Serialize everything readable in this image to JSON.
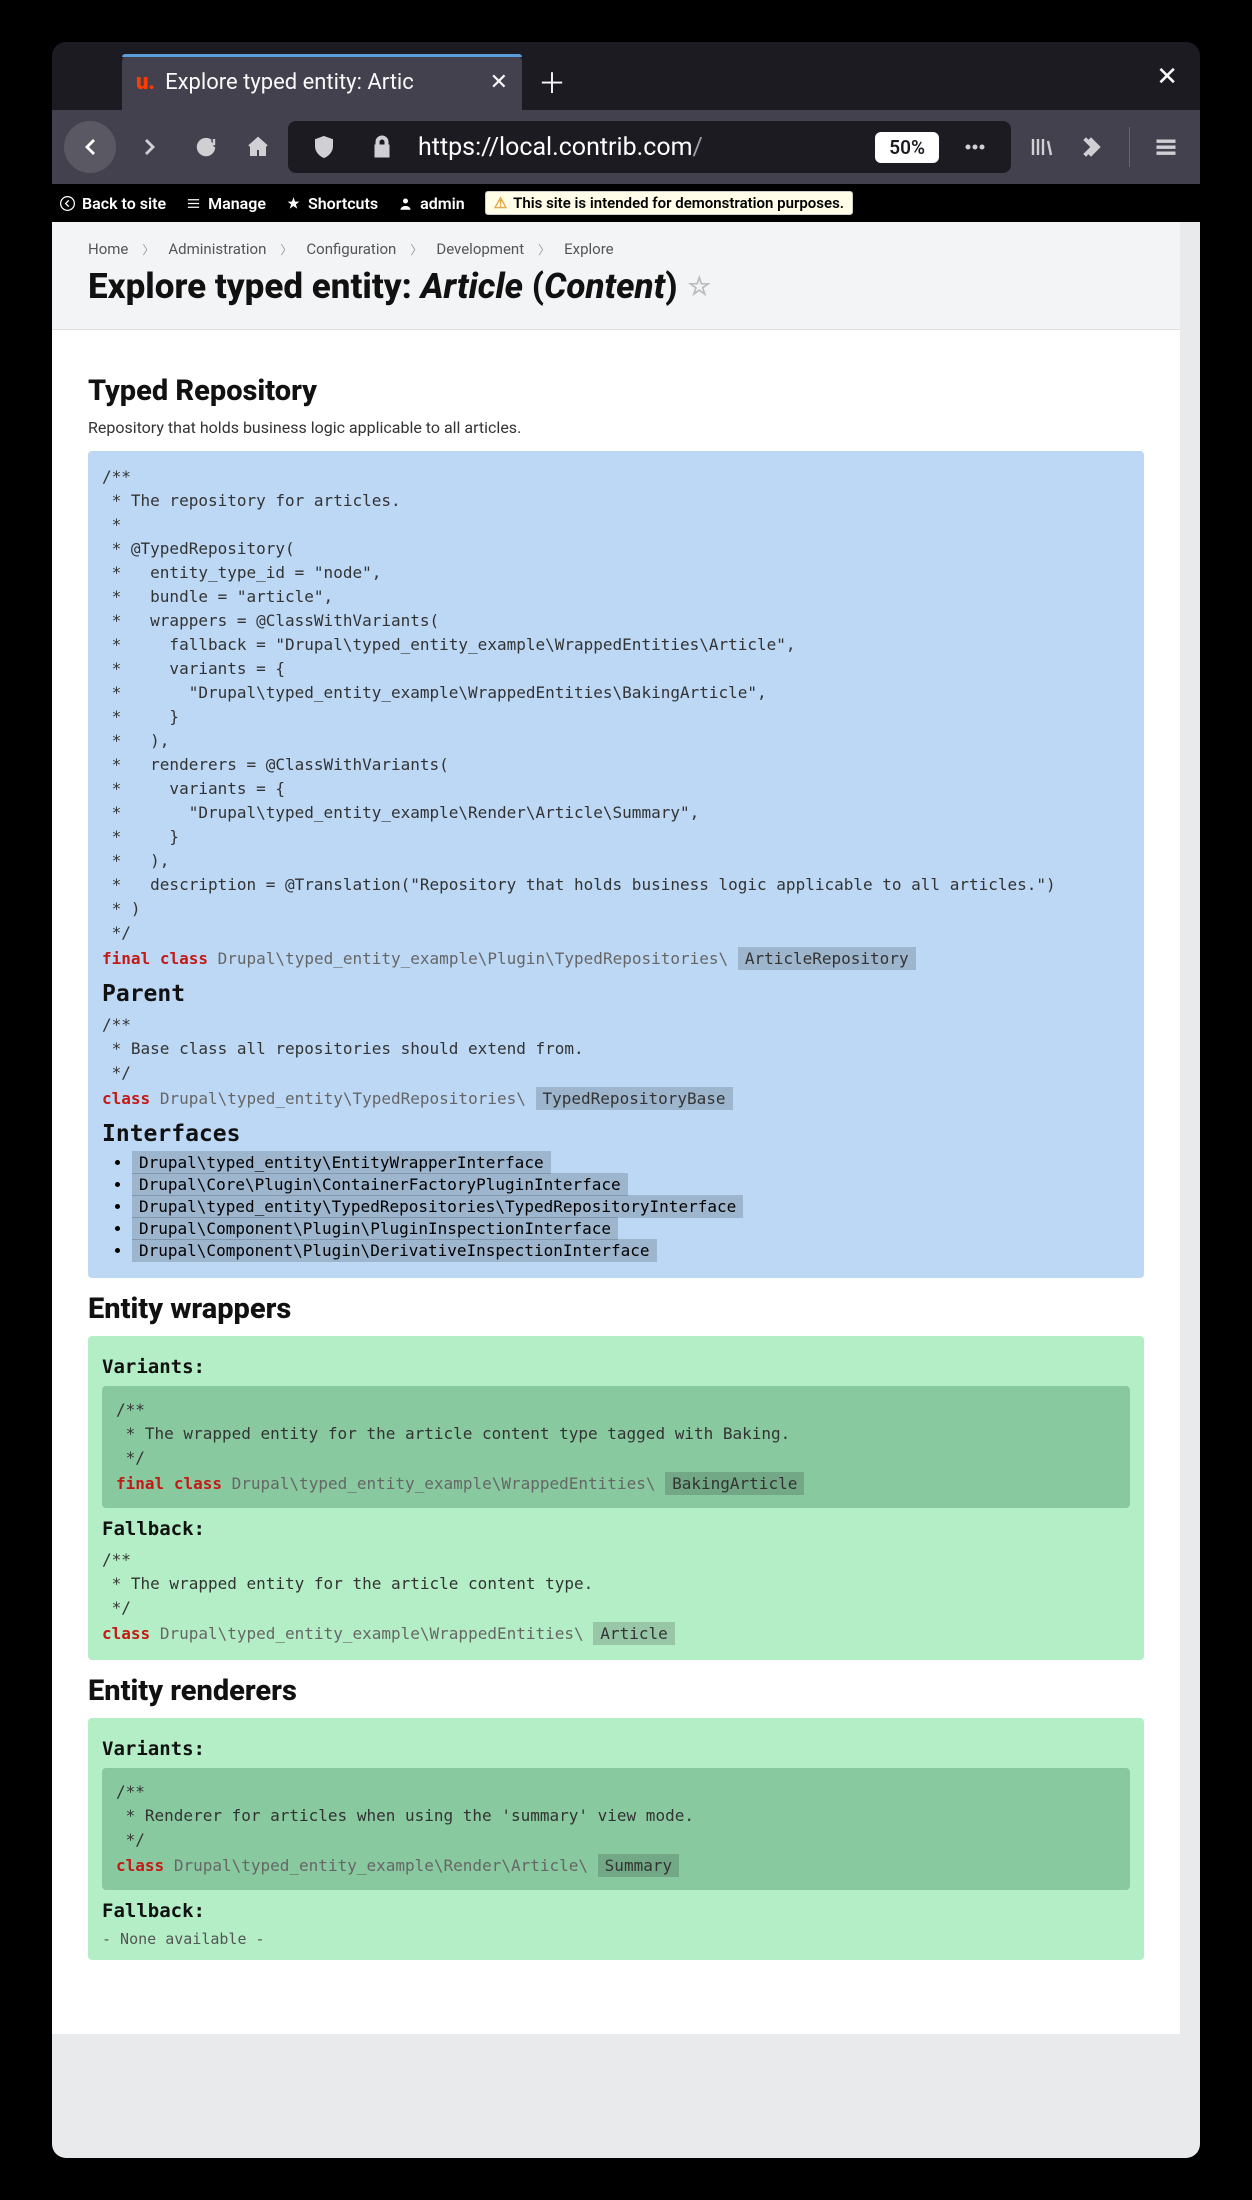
{
  "browser": {
    "tab_title": "Explore typed entity: Artic",
    "url_scheme": "https://",
    "url_domain": "local.contrib.com",
    "url_path": "/",
    "zoom": "50%"
  },
  "adminbar": {
    "back": "Back to site",
    "manage": "Manage",
    "shortcuts": "Shortcuts",
    "user": "admin",
    "warning": "This site is intended for demonstration purposes."
  },
  "breadcrumb": [
    "Home",
    "Administration",
    "Configuration",
    "Development",
    "Explore"
  ],
  "page_title": {
    "prefix": "Explore typed entity: ",
    "entity": "Article",
    "sub_open": " (",
    "sub": "Content",
    "sub_close": ")"
  },
  "sections": {
    "repo": {
      "heading": "Typed Repository",
      "desc": "Repository that holds business logic applicable to all articles.",
      "doc": "/**\n * The repository for articles.\n *\n * @TypedRepository(\n *   entity_type_id = \"node\",\n *   bundle = \"article\",\n *   wrappers = @ClassWithVariants(\n *     fallback = \"Drupal\\typed_entity_example\\WrappedEntities\\Article\",\n *     variants = {\n *       \"Drupal\\typed_entity_example\\WrappedEntities\\BakingArticle\",\n *     }\n *   ),\n *   renderers = @ClassWithVariants(\n *     variants = {\n *       \"Drupal\\typed_entity_example\\Render\\Article\\Summary\",\n *     }\n *   ),\n *   description = @Translation(\"Repository that holds business logic applicable to all articles.\")\n * )\n */",
      "decl_final": "final",
      "decl_class": "class",
      "decl_ns": "Drupal\\typed_entity_example\\Plugin\\TypedRepositories\\",
      "decl_name": "ArticleRepository",
      "parent_heading": "Parent",
      "parent_doc": "/**\n * Base class all repositories should extend from.\n */",
      "parent_class": "class",
      "parent_ns": "Drupal\\typed_entity\\TypedRepositories\\",
      "parent_name": "TypedRepositoryBase",
      "interfaces_heading": "Interfaces",
      "interfaces": [
        "Drupal\\typed_entity\\EntityWrapperInterface",
        "Drupal\\Core\\Plugin\\ContainerFactoryPluginInterface",
        "Drupal\\typed_entity\\TypedRepositories\\TypedRepositoryInterface",
        "Drupal\\Component\\Plugin\\PluginInspectionInterface",
        "Drupal\\Component\\Plugin\\DerivativeInspectionInterface"
      ]
    },
    "wrappers": {
      "heading": "Entity wrappers",
      "variants_heading": "Variants:",
      "variant_doc": "/**\n * The wrapped entity for the article content type tagged with Baking.\n */",
      "variant_final": "final",
      "variant_class": "class",
      "variant_ns": "Drupal\\typed_entity_example\\WrappedEntities\\",
      "variant_name": "BakingArticle",
      "fallback_heading": "Fallback:",
      "fallback_doc": "/**\n * The wrapped entity for the article content type.\n */",
      "fallback_class": "class",
      "fallback_ns": "Drupal\\typed_entity_example\\WrappedEntities\\",
      "fallback_name": "Article"
    },
    "renderers": {
      "heading": "Entity renderers",
      "variants_heading": "Variants:",
      "variant_doc": "/**\n * Renderer for articles when using the 'summary' view mode.\n */",
      "variant_class": "class",
      "variant_ns": "Drupal\\typed_entity_example\\Render\\Article\\",
      "variant_name": "Summary",
      "fallback_heading": "Fallback:",
      "fallback_none": "- None available -"
    }
  }
}
